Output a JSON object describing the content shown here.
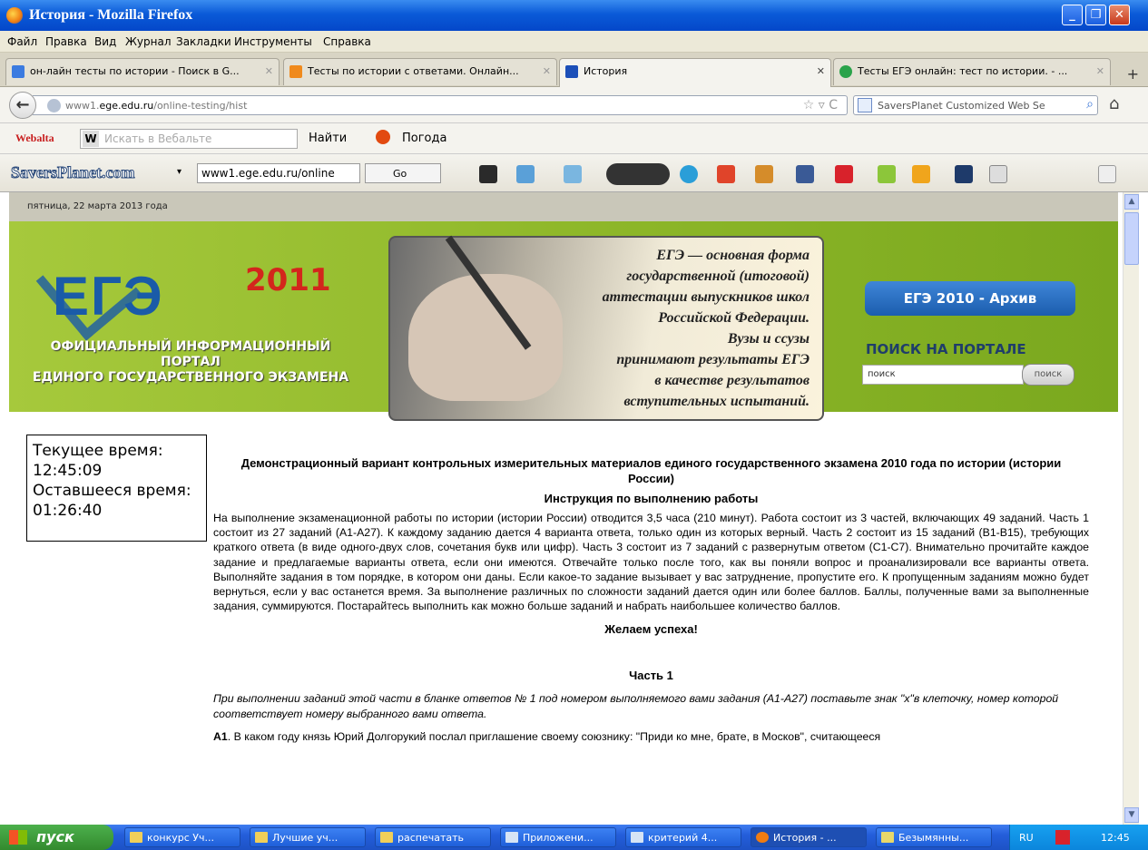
{
  "window": {
    "title": "История - Mozilla Firefox"
  },
  "menu": [
    "Файл",
    "Правка",
    "Вид",
    "Журнал",
    "Закладки",
    "Инструменты",
    "Справка"
  ],
  "tabs": [
    {
      "label": "он-лайн тесты по истории - Поиск в G...",
      "color": "#3b7be0"
    },
    {
      "label": "Тесты по истории с ответами. Онлайн...",
      "color": "#f08a1c"
    },
    {
      "label": "История",
      "color": "#1c4fb8"
    },
    {
      "label": "Тесты ЕГЭ онлайн: тест по истории. - ...",
      "color": "#2aa34a"
    }
  ],
  "nav": {
    "url_host": "www1.ege.edu.ru",
    "url_prefix": "www1.",
    "url_domain": "ege.edu.ru",
    "url_path": "/online-testing/hist",
    "search_placeholder": "SaversPlanet Customized Web Se"
  },
  "webalta": {
    "logo": "Webalta",
    "placeholder": "Искать в Вебальте",
    "find_label": "Найти",
    "weather_label": "Погода"
  },
  "saversplanet": {
    "logo": "SaversPlanet.com",
    "url": "www1.ege.edu.ru/online",
    "go_label": "Go"
  },
  "page": {
    "date": "пятница, 22 марта 2013 года",
    "banner": {
      "logo": "ЕГЭ",
      "year": "2011",
      "portal_line1": "ОФИЦИАЛЬНЫЙ ИНФОРМАЦИОННЫЙ ПОРТАЛ",
      "portal_line2": "ЕДИНОГО ГОСУДАРСТВЕННОГО ЭКЗАМЕНА",
      "quote_lines": [
        "ЕГЭ — основная форма",
        "государственной (итоговой)",
        "аттестации выпускников школ",
        "Российской Федерации.",
        "Вузы и ссузы",
        "принимают результаты ЕГЭ",
        "в качестве результатов",
        "вступительных испытаний."
      ],
      "archive_button": "ЕГЭ 2010 - Архив",
      "search_title": "ПОИСК НА ПОРТАЛЕ",
      "search_value": "поиск",
      "search_button": "поиск"
    },
    "timer": {
      "current_label": "Текущее время:",
      "current_value": "12:45:09",
      "remaining_label": "Оставшееся время:",
      "remaining_value": "01:26:40"
    },
    "doc_title": "Демонстрационный вариант контрольных измерительных материалов единого государственного экзамена 2010 года по истории (истории России)",
    "instructions_title": "Инструкция по выполнению работы",
    "instructions": "На выполнение экзаменационной работы по истории (истории России) отводится 3,5 часа (210 минут). Работа состоит из 3 частей, включающих 49 заданий. Часть 1 состоит из 27 заданий (А1-А27). К каждому заданию дается 4 варианта ответа, только один из которых верный. Часть 2 состоит из 15 заданий (В1-В15), требующих краткого ответа (в виде одного-двух слов, сочетания букв или цифр). Часть 3 состоит из 7 заданий с развернутым ответом (С1-С7). Внимательно прочитайте каждое задание и предлагаемые варианты ответа, если они имеются. Отвечайте только после того, как вы поняли вопрос и проанализировали все варианты ответа. Выполняйте задания в том порядке, в котором они даны. Если какое-то задание вызывает у вас затруднение, пропустите его. К пропущенным заданиям можно будет вернуться, если у вас останется время. За выполнение различных по сложности заданий дается один или более баллов. Баллы, полученные вами за выполненные задания, суммируются. Постарайтесь выполнить как можно больше заданий и набрать наибольшее количество баллов.",
    "wish": "Желаем успеха!",
    "part_title": "Часть 1",
    "part_note": "При выполнении заданий этой части в бланке ответов № 1 под номером выполняемого вами задания (А1-А27) поставьте знак \"х\"в клеточку, номер которой соответствует номеру выбранного вами ответа.",
    "question_label": "А1",
    "question_text": "В каком году князь Юрий Долгорукий послал приглашение своему союзнику: \"Приди ко мне, брате, в Москов\", считающееся"
  },
  "taskbar": {
    "start_label": "пуск",
    "tasks": [
      "конкурс Уч...",
      "Лучшие уч...",
      "распечатать",
      "Приложени...",
      "критерий 4...",
      "История - ...",
      "Безымянны..."
    ],
    "lang": "RU",
    "clock": "12:45"
  }
}
